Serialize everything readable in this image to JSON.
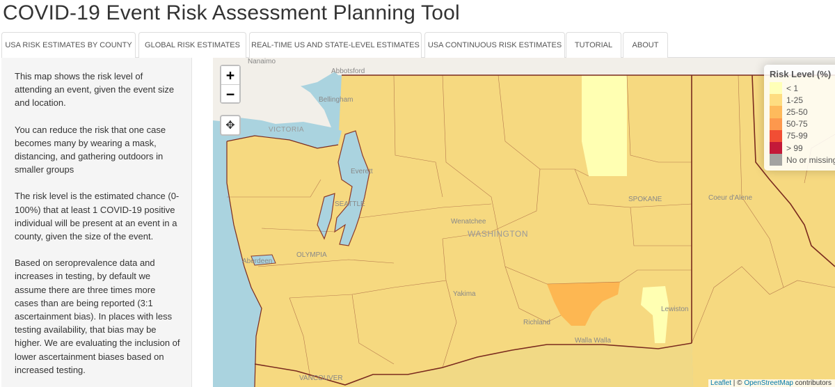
{
  "app": {
    "title": "COVID-19 Event Risk Assessment Planning Tool"
  },
  "tabs": [
    {
      "label": "USA RISK ESTIMATES BY COUNTY",
      "active": true
    },
    {
      "label": "GLOBAL RISK ESTIMATES",
      "active": false
    },
    {
      "label": "REAL-TIME US AND STATE-LEVEL ESTIMATES",
      "active": false
    },
    {
      "label": "USA CONTINUOUS RISK ESTIMATES",
      "active": false
    },
    {
      "label": "TUTORIAL",
      "active": false
    },
    {
      "label": "ABOUT",
      "active": false
    }
  ],
  "sidebar": {
    "paragraphs": [
      "This map shows the risk level of attending an event, given the event size and location.",
      "You can reduce the risk that one case becomes many by wearing a mask, distancing, and gathering outdoors in smaller groups",
      "The risk level is the estimated chance (0-100%) that at least 1 COVID-19 positive individual will be present at an event in a county, given the size of the event.",
      "Based on seroprevalence data and increases in testing, by default we assume there are three times more cases than are being reported (3:1 ascertainment bias). In places with less testing availability, that bias may be higher. We are evaluating the inclusion of lower ascertainment biases based on increased testing."
    ]
  },
  "map": {
    "controls": {
      "zoom_in": "+",
      "zoom_out": "−",
      "pan": "✥"
    },
    "legend": {
      "title": "Risk Level (%)",
      "items": [
        {
          "label": "< 1",
          "color": "#ffffb2"
        },
        {
          "label": "1-25",
          "color": "#fed976"
        },
        {
          "label": "25-50",
          "color": "#feb24c"
        },
        {
          "label": "50-75",
          "color": "#fd8d3c"
        },
        {
          "label": "75-99",
          "color": "#f03b20"
        },
        {
          "label": "> 99",
          "color": "#bd0026"
        },
        {
          "label": "No or missing data",
          "color": "#999999"
        }
      ]
    },
    "places": {
      "nanaimo": "Nanaimo",
      "abbotsford": "Abbotsford",
      "bellingham": "Bellingham",
      "victoria": "VICTORIA",
      "everett": "Everett",
      "seattle": "SEATTLE",
      "olympia": "OLYMPIA",
      "aberdeen": "Aberdeen",
      "wenatchee": "Wenatchee",
      "washington": "WASHINGTON",
      "spokane": "SPOKANE",
      "coeur_dalene": "Coeur d'Alene",
      "yakima": "Yakima",
      "lewiston": "Lewiston",
      "richland": "Richland",
      "walla_walla": "Walla Walla",
      "vancouver": "VANCOUVER"
    },
    "attribution": {
      "leaflet": "Leaflet",
      "separator": " | © ",
      "osm": "OpenStreetMap",
      "suffix": " contributors"
    }
  }
}
